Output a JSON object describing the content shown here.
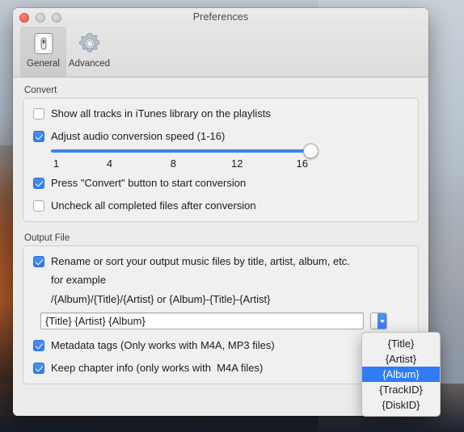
{
  "window": {
    "title": "Preferences",
    "traffic_lights": [
      "close-button",
      "minimize-button",
      "zoom-button"
    ]
  },
  "toolbar": {
    "items": [
      {
        "label": "General",
        "icon": "general-panel-icon",
        "selected": true
      },
      {
        "label": "Advanced",
        "icon": "gear-icon",
        "selected": false
      }
    ]
  },
  "convert": {
    "group_title": "Convert",
    "checkbox_show_all_tracks": {
      "label": "Show all tracks in iTunes library on the playlists",
      "checked": false
    },
    "checkbox_adjust_speed": {
      "label": "Adjust audio conversion speed (1-16)",
      "checked": true
    },
    "slider": {
      "min": 1,
      "max": 16,
      "value": 16,
      "ticks": [
        "1",
        "4",
        "8",
        "12",
        "16"
      ]
    },
    "checkbox_press_convert": {
      "label": "Press \"Convert\" button to start conversion",
      "checked": true
    },
    "checkbox_uncheck_completed": {
      "label": "Uncheck all completed files after conversion",
      "checked": false
    }
  },
  "output_file": {
    "group_title": "Output File",
    "checkbox_rename": {
      "label": "Rename or sort your output music files by title, artist, album, etc.",
      "checked": true
    },
    "example_heading": "for example",
    "example_pattern": "/{Album}/{Title}/{Artist} or {Album}-{Title}-{Artist}",
    "pattern_input": {
      "value": "{Title} {Artist} {Album}",
      "placeholder": "{Title} {Artist} {Album}"
    },
    "popup_button": "chevron-down-icon",
    "checkbox_metadata": {
      "label": "Metadata tags (Only works with M4A, MP3 files)",
      "checked": true
    },
    "checkbox_chapter": {
      "label": "Keep chapter info (only works with  M4A files)",
      "checked": true
    }
  },
  "dropdown": {
    "open": true,
    "selected": "{Album}",
    "items": [
      {
        "label": "{Title}",
        "selected": false
      },
      {
        "label": "{Artist}",
        "selected": false
      },
      {
        "label": "{Album}",
        "selected": true
      },
      {
        "label": "{TrackID}",
        "selected": false
      },
      {
        "label": "{DiskID}",
        "selected": false
      }
    ]
  },
  "colors": {
    "accent": "#2f7cf6",
    "window_bg": "#ececec",
    "close_button": "#fc5b52",
    "slider_track": "#3b82f6"
  }
}
